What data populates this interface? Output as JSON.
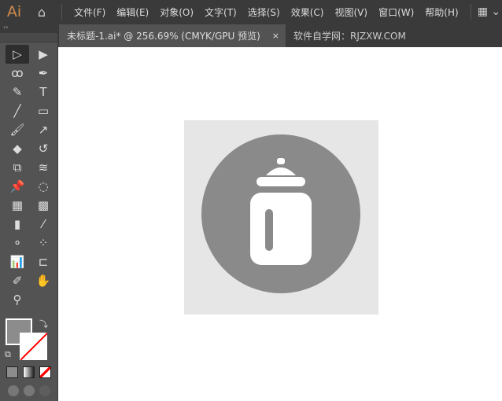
{
  "app": {
    "logo": "Ai",
    "menus": [
      "文件(F)",
      "编辑(E)",
      "对象(O)",
      "文字(T)",
      "选择(S)",
      "效果(C)",
      "视图(V)",
      "窗口(W)",
      "帮助(H)"
    ]
  },
  "tabs": [
    {
      "label": "未标题-1.ai* @ 256.69% (CMYK/GPU 预览)",
      "close": "×"
    },
    {
      "label": "软件自学网：RJZXW.COM"
    }
  ],
  "toolbox": {
    "collapse": "‹‹",
    "tools": [
      {
        "name": "selection",
        "glyph": "▷"
      },
      {
        "name": "direct-selection",
        "glyph": "▶"
      },
      {
        "name": "lasso",
        "glyph": "ꝏ"
      },
      {
        "name": "pen",
        "glyph": "✒"
      },
      {
        "name": "curvature",
        "glyph": "✎"
      },
      {
        "name": "type",
        "glyph": "T"
      },
      {
        "name": "line",
        "glyph": "╱"
      },
      {
        "name": "rectangle",
        "glyph": "▭"
      },
      {
        "name": "paintbrush",
        "glyph": "🖌"
      },
      {
        "name": "shaper",
        "glyph": "↗"
      },
      {
        "name": "eraser",
        "glyph": "◆"
      },
      {
        "name": "rotate",
        "glyph": "↺"
      },
      {
        "name": "scale",
        "glyph": "⧉"
      },
      {
        "name": "warp",
        "glyph": "≋"
      },
      {
        "name": "puppet-warp",
        "glyph": "📌"
      },
      {
        "name": "shape-builder",
        "glyph": "◌"
      },
      {
        "name": "perspective-grid",
        "glyph": "▦"
      },
      {
        "name": "mesh",
        "glyph": "▩"
      },
      {
        "name": "gradient",
        "glyph": "▮"
      },
      {
        "name": "eyedropper",
        "glyph": "⁄"
      },
      {
        "name": "blend",
        "glyph": "⚬"
      },
      {
        "name": "symbol-sprayer",
        "glyph": "⁘"
      },
      {
        "name": "column-graph",
        "glyph": "📊"
      },
      {
        "name": "artboard",
        "glyph": "⊏"
      },
      {
        "name": "slice",
        "glyph": "✐"
      },
      {
        "name": "hand",
        "glyph": "✋"
      },
      {
        "name": "zoom",
        "glyph": "⚲"
      }
    ]
  },
  "colors": {
    "fill": "#8c8c8c",
    "artboard": "#e6e6e6",
    "circle": "#8a8a8a",
    "logo": "#d08a4c"
  }
}
